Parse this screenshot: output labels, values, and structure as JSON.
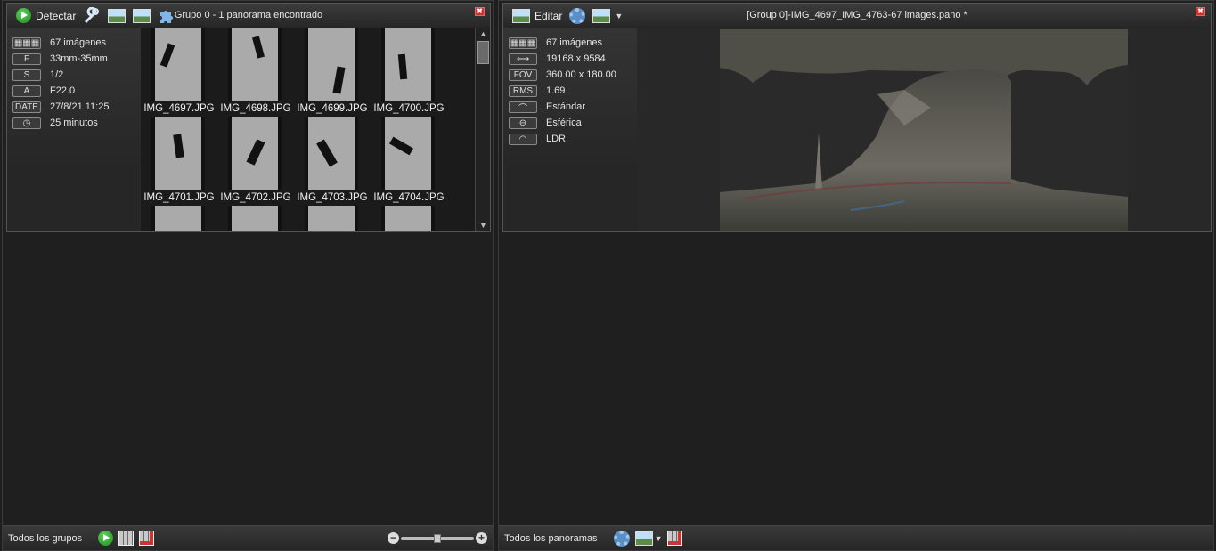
{
  "left": {
    "toolbar": {
      "detect_label": "Detectar",
      "title": "Grupo 0 - 1 panorama encontrado"
    },
    "info": [
      {
        "badge": "",
        "icon": "grid-badge-icon",
        "text": "67 imágenes"
      },
      {
        "badge": "F",
        "text": "33mm-35mm"
      },
      {
        "badge": "S",
        "text": "1/2"
      },
      {
        "badge": "A",
        "text": "F22.0"
      },
      {
        "badge": "DATE",
        "text": "27/8/21 11:25"
      },
      {
        "badge": "",
        "icon": "clock-icon",
        "text": "25 minutos"
      }
    ],
    "thumbnails": [
      "IMG_4697.JPG",
      "IMG_4698.JPG",
      "IMG_4699.JPG",
      "IMG_4700.JPG",
      "IMG_4701.JPG",
      "IMG_4702.JPG",
      "IMG_4703.JPG",
      "IMG_4704.JPG"
    ],
    "footer": {
      "label": "Todos los grupos"
    }
  },
  "right": {
    "toolbar": {
      "edit_label": "Editar",
      "title": "[Group 0]-IMG_4697_IMG_4763-67 images.pano *"
    },
    "info": [
      {
        "badge": "",
        "icon": "grid-badge-icon",
        "text": "67 imágenes"
      },
      {
        "badge": "",
        "icon": "arrows-icon",
        "text": "19168 x 9584"
      },
      {
        "badge": "FOV",
        "text": "360.00 x 180.00"
      },
      {
        "badge": "RMS",
        "text": "1.69"
      },
      {
        "badge": "",
        "icon": "standard-projection-icon",
        "text": "Estándar"
      },
      {
        "badge": "",
        "icon": "spherical-icon",
        "text": "Esférica"
      },
      {
        "badge": "",
        "icon": "ldr-icon",
        "text": "LDR"
      }
    ],
    "footer": {
      "label": "Todos los panoramas"
    }
  }
}
